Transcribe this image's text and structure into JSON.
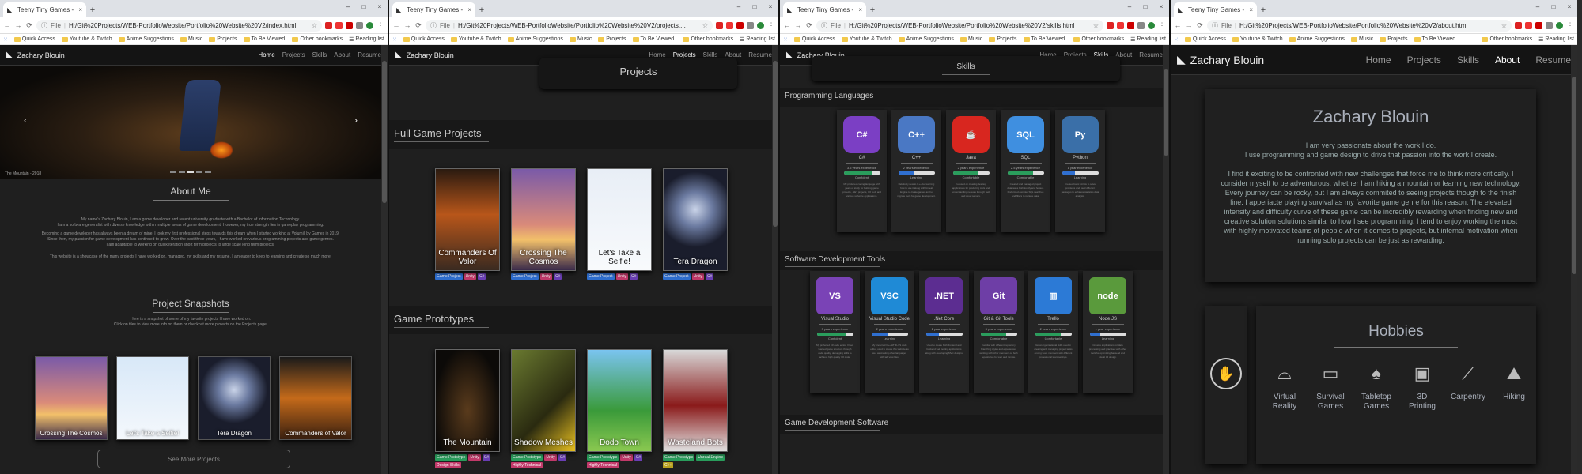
{
  "windows": [
    {
      "tab_title": "Teeny Tiny Games - Zachary Blou...",
      "url": "H:/Git%20Projects/WEB-PortfolioWebsite/Portfolio%20Website%20V2/index.html",
      "file_tag": "File",
      "bookmarks": [
        "Quick Access",
        "Youtube & Twitch",
        "Anime Suggestions",
        "Music",
        "Projects",
        "To Be Viewed"
      ],
      "other_bookmarks": "Other bookmarks",
      "reading_list": "Reading list",
      "brand": "Zachary Blouin",
      "nav": [
        "Home",
        "Projects",
        "Skills",
        "About",
        "Resume"
      ],
      "active_nav": "Home",
      "hero_caption": "The Mountain - 2018",
      "about_title": "About Me",
      "about_text": [
        "My name's Zachary Blouin, I am a game developer and recent university graduate with a Bachelor of Information Technology.",
        "I am a software generalist with diverse knowledge within multiple areas of game development. However, my true strength lies in gameplay programming.",
        "Becoming a game developer has always been a dream of mine. I took my first professional steps towards this dream when I started working at Volumill by Games in 2019.",
        "Since then, my passion for game development has continued to grow. Over the past three years, I have worked on various programming projects and game genres.",
        "I am adaptable to working on quick iteration short term projects to large scale long term projects.",
        "This website is a showcase of the many projects I have worked on, managed, my skills and my resume. I am eager to keep to learning and create so much more."
      ],
      "snap_title": "Project Snapshots",
      "snap_text": [
        "Here is a snapshot of some of my favorite projects I have worked on.",
        "Click on tiles to view more info on them or checkout more projects on the Projects page."
      ],
      "snapshots": [
        "Crossing The Cosmos",
        "Let's Take a Selfie!",
        "Tera Dragon",
        "Commanders of Valor"
      ],
      "more_button": "See More Projects"
    },
    {
      "tab_title": "Teeny Tiny Games - Projects",
      "url": "H:/Git%20Projects/WEB-PortfolioWebsite/Portfolio%20Website%20V2/projects....",
      "file_tag": "File",
      "bookmarks": [
        "Quick Access",
        "Youtube & Twitch",
        "Anime Suggestions",
        "Music",
        "Projects",
        "To Be Viewed"
      ],
      "other_bookmarks": "Other bookmarks",
      "reading_list": "Reading list",
      "brand": "Zachary Blouin",
      "nav": [
        "Home",
        "Projects",
        "Skills",
        "About",
        "Resume"
      ],
      "active_nav": "Projects",
      "page_title": "Projects",
      "section1": "Full Game Projects",
      "full_games": [
        {
          "title": "Commanders Of Valor",
          "tags": [
            {
              "t": "Game Project",
              "c": "#2f6fd0"
            },
            {
              "t": "Unity",
              "c": "#c23a6a"
            },
            {
              "t": "C#",
              "c": "#6a3fb5"
            }
          ]
        },
        {
          "title": "Crossing The Cosmos",
          "tags": [
            {
              "t": "Game Project",
              "c": "#2f6fd0"
            },
            {
              "t": "Unity",
              "c": "#c23a6a"
            },
            {
              "t": "C#",
              "c": "#6a3fb5"
            }
          ]
        },
        {
          "title": "Let's Take a Selfie!",
          "tags": [
            {
              "t": "Game Project",
              "c": "#2f6fd0"
            },
            {
              "t": "Unity",
              "c": "#c23a6a"
            },
            {
              "t": "C#",
              "c": "#6a3fb5"
            }
          ]
        },
        {
          "title": "Tera Dragon",
          "tags": [
            {
              "t": "Game Project",
              "c": "#2f6fd0"
            },
            {
              "t": "Unity",
              "c": "#c23a6a"
            },
            {
              "t": "C#",
              "c": "#6a3fb5"
            }
          ]
        }
      ],
      "section2": "Game Prototypes",
      "prototypes": [
        {
          "title": "The Mountain",
          "tags": [
            {
              "t": "Game Prototype",
              "c": "#2a9d5c"
            },
            {
              "t": "Unity",
              "c": "#c23a6a"
            },
            {
              "t": "C#",
              "c": "#6a3fb5"
            },
            {
              "t": "Design Skills",
              "c": "#c23a6a"
            }
          ]
        },
        {
          "title": "Shadow Meshes",
          "tags": [
            {
              "t": "Game Prototype",
              "c": "#2a9d5c"
            },
            {
              "t": "Unity",
              "c": "#c23a6a"
            },
            {
              "t": "C#",
              "c": "#6a3fb5"
            },
            {
              "t": "Highly Technical",
              "c": "#c23a6a"
            }
          ]
        },
        {
          "title": "Dodo Town",
          "tags": [
            {
              "t": "Game Prototype",
              "c": "#2a9d5c"
            },
            {
              "t": "Unity",
              "c": "#c23a6a"
            },
            {
              "t": "C#",
              "c": "#6a3fb5"
            },
            {
              "t": "Highly Technical",
              "c": "#c23a6a"
            }
          ]
        },
        {
          "title": "Wasteland Bots",
          "tags": [
            {
              "t": "Game Prototype",
              "c": "#2a9d5c"
            },
            {
              "t": "Unreal Engine",
              "c": "#2a9d5c"
            },
            {
              "t": "C++",
              "c": "#b8a020"
            }
          ]
        }
      ]
    },
    {
      "tab_title": "Teeny Tiny Games - Skills",
      "url": "H:/Git%20Projects/WEB-PortfolioWebsite/Portfolio%20Website%20V2/skills.html",
      "file_tag": "File",
      "bookmarks": [
        "Quick Access",
        "Youtube & Twitch",
        "Anime Suggestions",
        "Music",
        "Projects",
        "To Be Viewed"
      ],
      "other_bookmarks": "Other bookmarks",
      "reading_list": "Reading list",
      "brand": "Zachary Blouin",
      "nav": [
        "Home",
        "Projects",
        "Skills",
        "About",
        "Resume"
      ],
      "active_nav": "Skills",
      "page_title": "Skills",
      "section1": "Programming Languages",
      "languages": [
        {
          "name": "C#",
          "icon": "C#",
          "color": "#7b3fc4",
          "exp": "3.5 years experience",
          "level": "Confident",
          "fill": 0.8,
          "fillc": "#2a9d5c",
          "desc": "My preferred coding language with years of study for building game projects, .NET projects, C# tools and various software applications."
        },
        {
          "name": "C++",
          "icon": "C++",
          "color": "#4a78c4",
          "exp": "2 years experience",
          "level": "Learning",
          "fill": 0.45,
          "fillc": "#2f6fd0",
          "desc": "Relatively new to C++ but learning how to use it along with Unreal Engine to create games and to migrate tools for game development."
        },
        {
          "name": "Java",
          "icon": "☕",
          "color": "#d8261f",
          "exp": "2 years experience",
          "level": "Comfortable",
          "fill": 0.7,
          "fillc": "#2a9d5c",
          "desc": "Focused on creating desktop applications for producing tools and understanding network through web and cloud servers."
        },
        {
          "name": "SQL",
          "icon": "SQL",
          "color": "#3f8fe0",
          "exp": "2.5 years experience",
          "level": "Comfortable",
          "fill": 0.7,
          "fillc": "#2a9d5c",
          "desc": "Created and managed project databases both locally and hosted. Preformed complex SQL searches and filters to retrieve data."
        },
        {
          "name": "Python",
          "icon": "Py",
          "color": "#3a6fa8",
          "exp": "1 year experience",
          "level": "Learning",
          "fill": 0.35,
          "fillc": "#2f6fd0",
          "desc": "Created basic scripts to solve problems and used different packages to enhance statistics data analysis."
        }
      ],
      "section2": "Software Development Tools",
      "tools": [
        {
          "name": "Visual Studio",
          "icon": "VS",
          "color": "#7a43b6",
          "exp": "3 years experience",
          "level": "Confident",
          "fill": 0.8,
          "fillc": "#2a9d5c",
          "desc": "My preferred C# code editor. I have learned game structure through code quality, debugging skills to achieve high quality C# code."
        },
        {
          "name": "Visual Studio Code",
          "icon": "VSC",
          "color": "#1f8ad6",
          "exp": "2 years experience",
          "level": "Learning",
          "fill": 0.45,
          "fillc": "#2f6fd0",
          "desc": "My preferred C++/HTML/JS code editor, used to create this website as well as creating other languages with tab view files."
        },
        {
          "name": ".Net Core",
          "icon": ".NET",
          "color": "#5c2d91",
          "exp": "1 year experience",
          "level": "Learning",
          "fill": 0.35,
          "fillc": "#2f6fd0",
          "desc": "Used to create both frontend and backend web testing applications along with developing MVC designs."
        },
        {
          "name": "Git & Git Tools",
          "icon": "Git",
          "color": "#6e3ea6",
          "exp": "3 years experience",
          "level": "Comfortable",
          "fill": 0.7,
          "fillc": "#2a9d5c",
          "desc": "Familiar with different repository branching styles and experienced working with other members on both repositories for web and remote."
        },
        {
          "name": "Trello",
          "icon": "▥",
          "color": "#2c7ad6",
          "exp": "2 years experience",
          "level": "Comfortable",
          "fill": 0.7,
          "fillc": "#2a9d5c",
          "desc": "Great organisational skills used in creating and managing project tasks among team members with different professional team settings."
        },
        {
          "name": "Node.JS",
          "icon": "node",
          "color": "#5a9a3c",
          "exp": "1 year experience",
          "level": "Learning",
          "fill": 0.3,
          "fillc": "#2f6fd0",
          "desc": "Creates applications for data processing and practised with other tools for optimising backend and visual 3d design."
        }
      ],
      "section3": "Game Development Software"
    },
    {
      "tab_title": "Teeny Tiny Games - About",
      "url": "H:/Git%20Projects/WEB-PortfolioWebsite/Portfolio%20Website%20V2/about.html",
      "file_tag": "File",
      "bookmarks": [
        "Quick Access",
        "Youtube & Twitch",
        "Anime Suggestions",
        "Music",
        "Projects",
        "To Be Viewed"
      ],
      "other_bookmarks": "Other bookmarks",
      "reading_list": "Reading list",
      "brand": "Zachary Blouin",
      "nav": [
        "Home",
        "Projects",
        "Skills",
        "About",
        "Resume"
      ],
      "active_nav": "About",
      "about_name": "Zachary Blouin",
      "about_p1": [
        "I am very passionate about the work I do.",
        "I use programming and game design to drive that passion into the work I create."
      ],
      "about_p2": "I find it exciting to be confronted with new challenges that force me to think more critically. I consider myself to be adventurous, whether I am hiking a mountain or learning new technology. Every journey can be rocky, but I am always commited to seeing projects though to the finish line. I apperiacte playing survival as my favorite game genre for this reason. The elevated intensity and difficulty curve of these game can be incredibly rewarding when finding new and creative solution solutions similar to how I see programming. I tend to enjoy working the most with highly motivated teams of people when it comes to projects, but internal motivation when running solo projects can be just as rewarding.",
      "hobbies_title": "Hobbies",
      "hobbies": [
        {
          "name": "Virtual Reality",
          "icon": "vr-headset-icon",
          "glyph": "⌓"
        },
        {
          "name": "Survival Games",
          "icon": "laptop-icon",
          "glyph": "▭"
        },
        {
          "name": "Tabletop Games",
          "icon": "cards-icon",
          "glyph": "♠"
        },
        {
          "name": "3D Printing",
          "icon": "printer-icon",
          "glyph": "▣"
        },
        {
          "name": "Carpentry",
          "icon": "saw-icon",
          "glyph": "⟋"
        },
        {
          "name": "Hiking",
          "icon": "hiker-icon",
          "glyph": "⛰"
        }
      ]
    }
  ]
}
